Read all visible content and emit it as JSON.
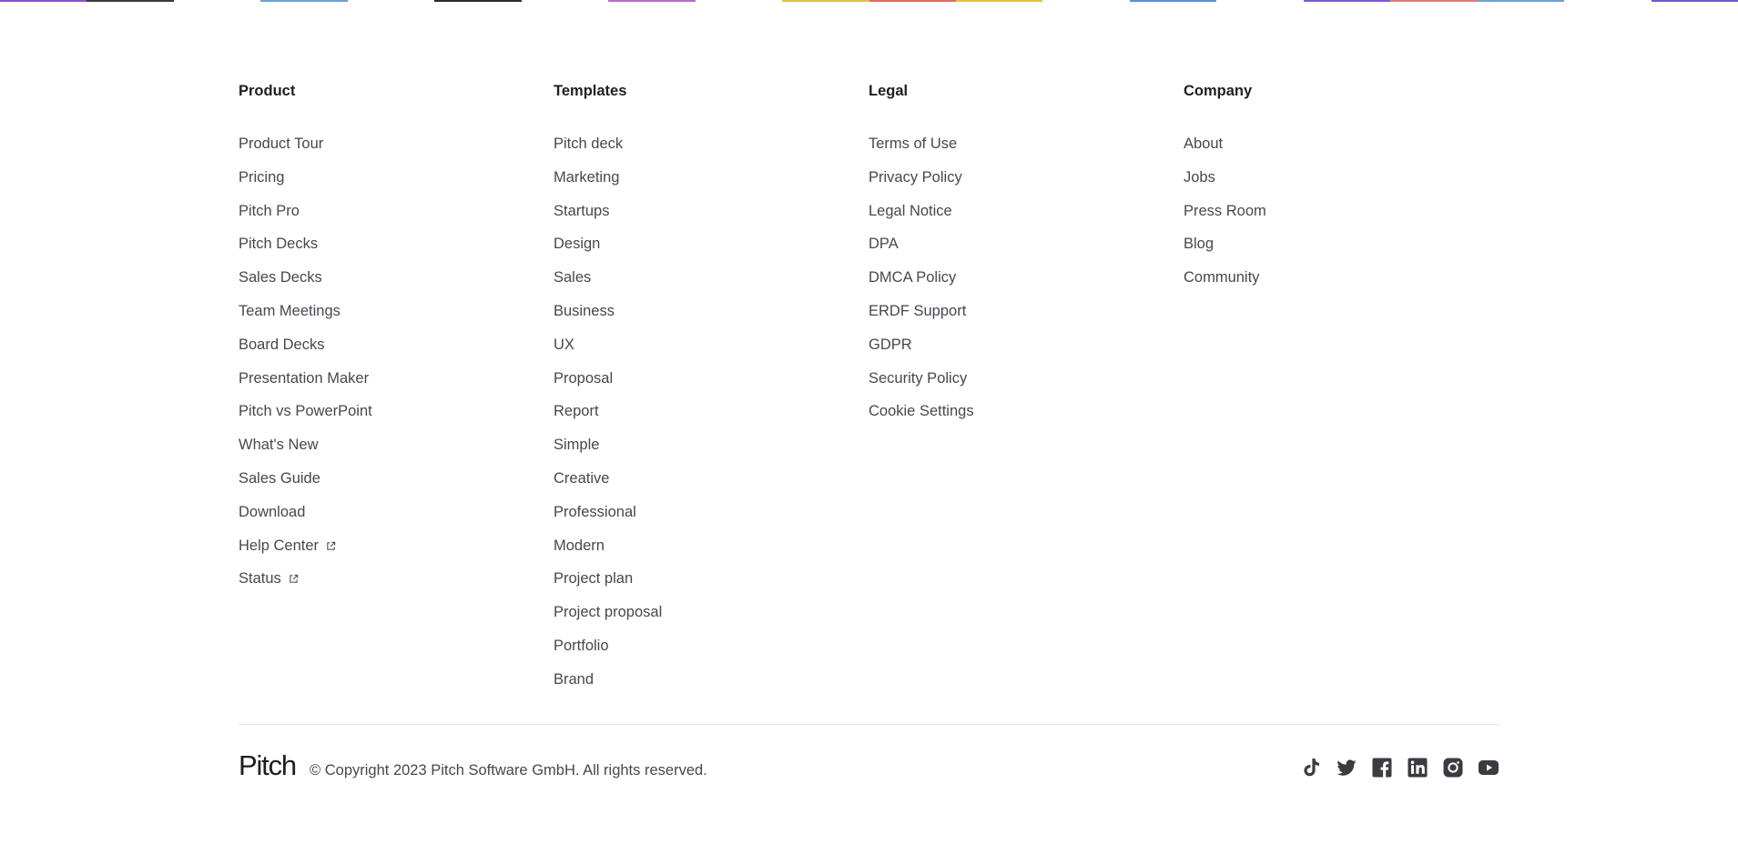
{
  "top_strip": {
    "colors": [
      "#8a4fd1",
      "#3a3a3a",
      "#ffffff",
      "#6aa3d8",
      "#ffffff",
      "#2b2b2b",
      "#ffffff",
      "#b76ad6",
      "#ffffff",
      "#e0c04a",
      "#e36a5c",
      "#e8c13a",
      "#ffffff",
      "#5a8fd8",
      "#ffffff",
      "#7a5ad8",
      "#e07b7b",
      "#6aa3d8",
      "#ffffff",
      "#6a5ad8"
    ]
  },
  "columns": [
    {
      "title": "Product",
      "links": [
        {
          "label": "Product Tour",
          "external": false
        },
        {
          "label": "Pricing",
          "external": false
        },
        {
          "label": "Pitch Pro",
          "external": false
        },
        {
          "label": "Pitch Decks",
          "external": false
        },
        {
          "label": "Sales Decks",
          "external": false
        },
        {
          "label": "Team Meetings",
          "external": false
        },
        {
          "label": "Board Decks",
          "external": false
        },
        {
          "label": "Presentation Maker",
          "external": false
        },
        {
          "label": "Pitch vs PowerPoint",
          "external": false
        },
        {
          "label": "What's New",
          "external": false
        },
        {
          "label": "Sales Guide",
          "external": false
        },
        {
          "label": "Download",
          "external": false
        },
        {
          "label": "Help Center",
          "external": true
        },
        {
          "label": "Status",
          "external": true
        }
      ]
    },
    {
      "title": "Templates",
      "links": [
        {
          "label": "Pitch deck",
          "external": false
        },
        {
          "label": "Marketing",
          "external": false
        },
        {
          "label": "Startups",
          "external": false
        },
        {
          "label": "Design",
          "external": false
        },
        {
          "label": "Sales",
          "external": false
        },
        {
          "label": "Business",
          "external": false
        },
        {
          "label": "UX",
          "external": false
        },
        {
          "label": "Proposal",
          "external": false
        },
        {
          "label": "Report",
          "external": false
        },
        {
          "label": "Simple",
          "external": false
        },
        {
          "label": "Creative",
          "external": false
        },
        {
          "label": "Professional",
          "external": false
        },
        {
          "label": "Modern",
          "external": false
        },
        {
          "label": "Project plan",
          "external": false
        },
        {
          "label": "Project proposal",
          "external": false
        },
        {
          "label": "Portfolio",
          "external": false
        },
        {
          "label": "Brand",
          "external": false
        }
      ]
    },
    {
      "title": "Legal",
      "links": [
        {
          "label": "Terms of Use",
          "external": false
        },
        {
          "label": "Privacy Policy",
          "external": false
        },
        {
          "label": "Legal Notice",
          "external": false
        },
        {
          "label": "DPA",
          "external": false
        },
        {
          "label": "DMCA Policy",
          "external": false
        },
        {
          "label": "ERDF Support",
          "external": false
        },
        {
          "label": "GDPR",
          "external": false
        },
        {
          "label": "Security Policy",
          "external": false
        },
        {
          "label": "Cookie Settings",
          "external": false
        }
      ]
    },
    {
      "title": "Company",
      "links": [
        {
          "label": "About",
          "external": false
        },
        {
          "label": "Jobs",
          "external": false
        },
        {
          "label": "Press Room",
          "external": false
        },
        {
          "label": "Blog",
          "external": false
        },
        {
          "label": "Community",
          "external": false
        }
      ]
    }
  ],
  "footer": {
    "logo_text": "Pitch",
    "copyright": "© Copyright 2023 Pitch Software GmbH. All rights reserved."
  },
  "socials": [
    {
      "name": "tiktok-icon",
      "label": "TikTok"
    },
    {
      "name": "twitter-icon",
      "label": "Twitter"
    },
    {
      "name": "facebook-icon",
      "label": "Facebook"
    },
    {
      "name": "linkedin-icon",
      "label": "LinkedIn"
    },
    {
      "name": "instagram-icon",
      "label": "Instagram"
    },
    {
      "name": "youtube-icon",
      "label": "YouTube"
    }
  ],
  "colors": {
    "heading": "#1e1e24",
    "link": "#47474f",
    "divider": "#e2e2e6",
    "icon": "#3b3b42"
  }
}
